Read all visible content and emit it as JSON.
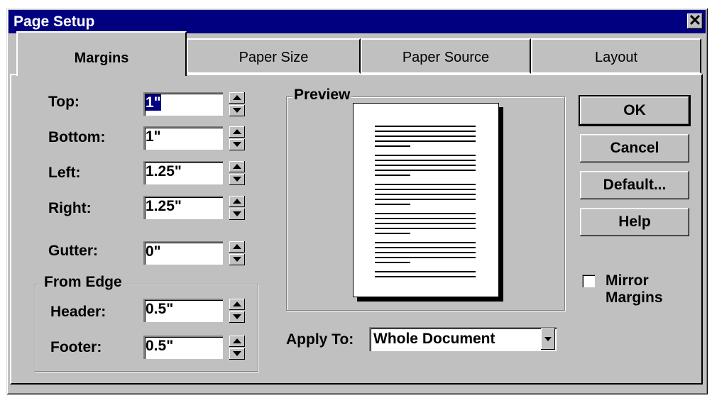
{
  "window": {
    "title": "Page Setup",
    "close_glyph": "✕"
  },
  "tabs": [
    {
      "label": "Margins",
      "underline": "M",
      "active": true
    },
    {
      "label": "Paper Size",
      "underline": "S"
    },
    {
      "label": "Paper Source",
      "underline": "P"
    },
    {
      "label": "Layout",
      "underline": "L"
    }
  ],
  "fields": {
    "top": {
      "label": "Top:",
      "value": "1\""
    },
    "bottom": {
      "label": "Bottom:",
      "value": "1\""
    },
    "left": {
      "label": "Left:",
      "value": "1.25\""
    },
    "right": {
      "label": "Right:",
      "value": "1.25\""
    },
    "gutter": {
      "label": "Gutter:",
      "value": "0\""
    }
  },
  "from_edge": {
    "title": "From Edge",
    "header": {
      "label": "Header:",
      "value": "0.5\""
    },
    "footer": {
      "label": "Footer:",
      "value": "0.5\""
    }
  },
  "preview": {
    "title": "Preview"
  },
  "apply_to": {
    "label": "Apply To:",
    "value": "Whole Document"
  },
  "buttons": {
    "ok": "OK",
    "cancel": "Cancel",
    "default": "Default...",
    "help": "Help"
  },
  "mirror_margins": {
    "label_line1": "Mirror",
    "label_line2": "Margins",
    "checked": false
  }
}
